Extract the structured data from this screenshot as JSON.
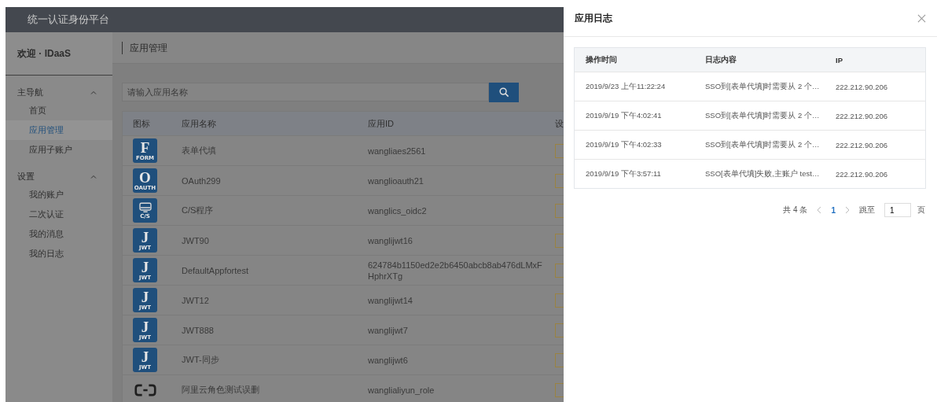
{
  "header": {
    "title": "统一认证身份平台"
  },
  "sidebar": {
    "welcome": "欢迎 · IDaaS",
    "sections": [
      {
        "label": "主导航",
        "expanded": true,
        "items": [
          {
            "label": "首页",
            "selected": false
          },
          {
            "label": "应用管理",
            "selected": true
          },
          {
            "label": "应用子账户",
            "selected": false
          }
        ]
      },
      {
        "label": "设置",
        "expanded": true,
        "items": [
          {
            "label": "我的账户",
            "selected": false
          },
          {
            "label": "二次认证",
            "selected": false
          },
          {
            "label": "我的消息",
            "selected": false
          },
          {
            "label": "我的日志",
            "selected": false
          }
        ]
      }
    ]
  },
  "page": {
    "title": "应用管理",
    "search": {
      "placeholder": "请输入应用名称"
    },
    "table": {
      "columns": [
        "图标",
        "应用名称",
        "应用ID",
        "设"
      ],
      "rows": [
        {
          "icon": {
            "kind": "letter",
            "letter": "F",
            "caption": "FORM"
          },
          "name": "表单代填",
          "app_id": "wangliaes2561"
        },
        {
          "icon": {
            "kind": "letter",
            "letter": "O",
            "caption": "OAUTH"
          },
          "name": "OAuth299",
          "app_id": "wanglioauth21"
        },
        {
          "icon": {
            "kind": "monitor",
            "caption": "C/S"
          },
          "name": "C/S程序",
          "app_id": "wanglics_oidc2"
        },
        {
          "icon": {
            "kind": "letter",
            "letter": "J",
            "caption": "JWT"
          },
          "name": "JWT90",
          "app_id": "wanglijwt16"
        },
        {
          "icon": {
            "kind": "letter",
            "letter": "J",
            "caption": "JWT"
          },
          "name": "DefaultAppfortest",
          "app_id": "624784b1150ed2e2b6450abcb8ab476dLMxFHphrXTg"
        },
        {
          "icon": {
            "kind": "letter",
            "letter": "J",
            "caption": "JWT"
          },
          "name": "JWT12",
          "app_id": "wanglijwt14"
        },
        {
          "icon": {
            "kind": "letter",
            "letter": "J",
            "caption": "JWT"
          },
          "name": "JWT888",
          "app_id": "wanglijwt7"
        },
        {
          "icon": {
            "kind": "letter",
            "letter": "J",
            "caption": "JWT"
          },
          "name": "JWT-同步",
          "app_id": "wanglijwt6"
        },
        {
          "icon": {
            "kind": "cloud"
          },
          "name": "阿里云角色测试误删",
          "app_id": "wanglialiyun_role"
        }
      ]
    }
  },
  "drawer": {
    "title": "应用日志",
    "table": {
      "columns": [
        "操作时间",
        "日志内容",
        "IP"
      ],
      "rows": [
        {
          "time": "2019/9/23 上午11:22:24",
          "content": "SSO到[表单代填]时需要从 2 个…",
          "ip": "222.212.90.206"
        },
        {
          "time": "2019/9/19 下午4:02:41",
          "content": "SSO到[表单代填]时需要从 2 个…",
          "ip": "222.212.90.206"
        },
        {
          "time": "2019/9/19 下午4:02:33",
          "content": "SSO到[表单代填]时需要从 2 个…",
          "ip": "222.212.90.206"
        },
        {
          "time": "2019/9/19 下午3:57:11",
          "content": "SSO[表单代填]失败,主账户 test…",
          "ip": "222.212.90.206"
        }
      ]
    },
    "pagination": {
      "total": "共 4 条",
      "pages": [
        {
          "label": "1",
          "selected": true
        }
      ],
      "jump_label": "跳至",
      "jump_value": "1",
      "unit": "页"
    }
  }
}
